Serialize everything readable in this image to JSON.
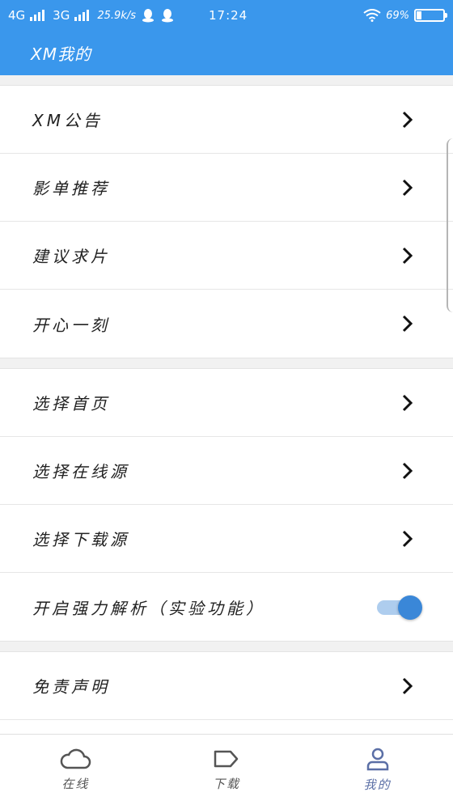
{
  "status_bar": {
    "network1": "4G",
    "network2": "3G",
    "speed": "25.9k/s",
    "time": "17:24",
    "battery_pct": "69%"
  },
  "app_bar": {
    "title": "XM我的"
  },
  "groups": [
    {
      "items": [
        {
          "label": "XM公告",
          "control": "chevron"
        },
        {
          "label": "影单推荐",
          "control": "chevron"
        },
        {
          "label": "建议求片",
          "control": "chevron"
        },
        {
          "label": "开心一刻",
          "control": "chevron"
        }
      ]
    },
    {
      "items": [
        {
          "label": "选择首页",
          "control": "chevron"
        },
        {
          "label": "选择在线源",
          "control": "chevron"
        },
        {
          "label": "选择下载源",
          "control": "chevron"
        },
        {
          "label": "开启强力解析（实验功能）",
          "control": "toggle",
          "value": true
        }
      ]
    },
    {
      "items": [
        {
          "label": "免责声明",
          "control": "chevron"
        },
        {
          "label": "",
          "control": "none"
        }
      ]
    }
  ],
  "tabs": [
    {
      "label": "在线",
      "icon": "cloud-icon",
      "active": false
    },
    {
      "label": "下载",
      "icon": "tag-icon",
      "active": false
    },
    {
      "label": "我的",
      "icon": "user-icon",
      "active": true
    }
  ],
  "colors": {
    "primary": "#3a97ec",
    "toggle_on": "#3a87d8",
    "tab_active": "#5b6fa6"
  }
}
